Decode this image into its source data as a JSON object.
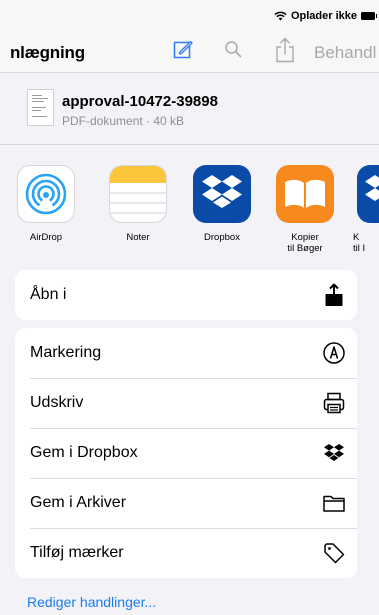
{
  "status_bar": {
    "charging_text": "Oplader ikke"
  },
  "nav": {
    "title": "nlægning",
    "action_label": "Behandl",
    "icons": [
      "edit-icon",
      "search-icon",
      "share-icon"
    ],
    "accent_color": "#2f7cf6"
  },
  "document": {
    "name": "approval-10472-39898",
    "meta": "PDF-dokument · 40 kB"
  },
  "apps": [
    {
      "label": "AirDrop",
      "icon": "airdrop-icon"
    },
    {
      "label": "Noter",
      "icon": "notes-icon"
    },
    {
      "label": "Dropbox",
      "icon": "dropbox-icon"
    },
    {
      "label": "Kopier\ntil Bøger",
      "icon": "books-icon"
    },
    {
      "label": "K\ntil I",
      "icon": "partial-app-icon"
    }
  ],
  "actions_primary": [
    {
      "label": "Åbn i",
      "icon": "open-in-icon"
    }
  ],
  "actions": [
    {
      "label": "Markering",
      "icon": "markup-icon"
    },
    {
      "label": "Udskriv",
      "icon": "print-icon"
    },
    {
      "label": "Gem i Dropbox",
      "icon": "dropbox-icon"
    },
    {
      "label": "Gem i Arkiver",
      "icon": "folder-icon"
    },
    {
      "label": "Tilføj mærker",
      "icon": "tag-icon"
    }
  ],
  "edit_actions_label": "Rediger handlinger..."
}
